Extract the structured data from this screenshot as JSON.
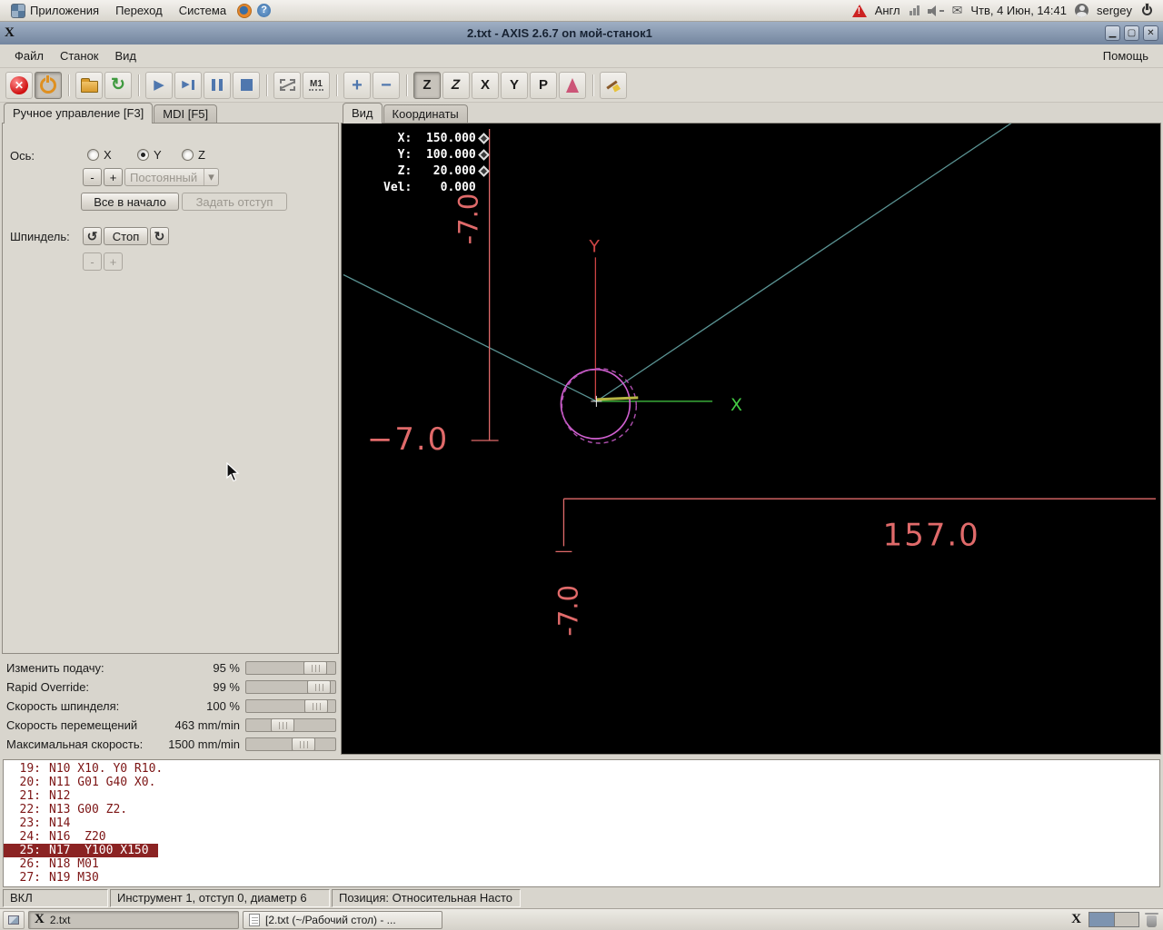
{
  "panel": {
    "applications": "Приложения",
    "places": "Переход",
    "system": "Система",
    "layout": "Англ",
    "clock": "Чтв, 4 Июн, 14:41",
    "user": "sergey"
  },
  "window": {
    "title": "2.txt - AXIS 2.6.7 on мой-станок1"
  },
  "menubar": {
    "file": "Файл",
    "machine": "Станок",
    "view": "Вид",
    "help": "Помощь"
  },
  "toolbar": {
    "view_z": "Z",
    "view_z_rot": "Z",
    "view_x": "X",
    "view_y": "Y",
    "view_p": "P",
    "optional_stop": "M1"
  },
  "tabs": {
    "manual": "Ручное управление [F3]",
    "mdi": "MDI [F5]",
    "preview": "Вид",
    "coords": "Координаты"
  },
  "manual": {
    "axis_label": "Ось:",
    "axis_x": "X",
    "axis_y": "Y",
    "axis_z": "Z",
    "jog_minus": "-",
    "jog_plus": "+",
    "jog_mode": "Постоянный",
    "home_all": "Все в начало",
    "touch_off": "Задать отступ",
    "spindle_label": "Шпиндель:",
    "spindle_stop": "Стоп",
    "spindle_minus": "-",
    "spindle_plus": "+"
  },
  "overrides": [
    {
      "label": "Изменить подачу:",
      "value": "95 %",
      "pos": 90
    },
    {
      "label": "Rapid Override:",
      "value": "99 %",
      "pos": 96
    },
    {
      "label": "Скорость шпинделя:",
      "value": "100 %",
      "pos": 92
    },
    {
      "label": "Скорость перемещений",
      "value": "463 mm/min",
      "pos": 38
    },
    {
      "label": "Максимальная скорость:",
      "value": "1500 mm/min",
      "pos": 72
    }
  ],
  "preview": {
    "dro": "  X:  150.000\n  Y:  100.000\n  Z:   20.000\nVel:    0.000",
    "axis_x": "X",
    "axis_y": "Y",
    "dim_left_rot": "-7.0",
    "dim_left": "−7.0",
    "dim_width": "157.0",
    "dim_bottom_rot": "-7.0"
  },
  "gcode": [
    {
      "n": "19:",
      "t": "N10 X10. Y0 R10."
    },
    {
      "n": "20:",
      "t": "N11 G01 G40 X0."
    },
    {
      "n": "21:",
      "t": "N12"
    },
    {
      "n": "22:",
      "t": "N13 G00 Z2."
    },
    {
      "n": "23:",
      "t": "N14"
    },
    {
      "n": "24:",
      "t": "N16  Z20"
    },
    {
      "n": "25:",
      "t": "N17  Y100 X150"
    },
    {
      "n": "26:",
      "t": "N18 M01"
    },
    {
      "n": "27:",
      "t": "N19 M30"
    }
  ],
  "status": {
    "machine": "ВКЛ",
    "tool": "Инструмент 1, отступ 0, диаметр 6",
    "position": "Позиция: Относительная Насто"
  },
  "taskbar": {
    "task1": "2.txt",
    "task2": "[2.txt (~/Рабочий стол) - ..."
  }
}
